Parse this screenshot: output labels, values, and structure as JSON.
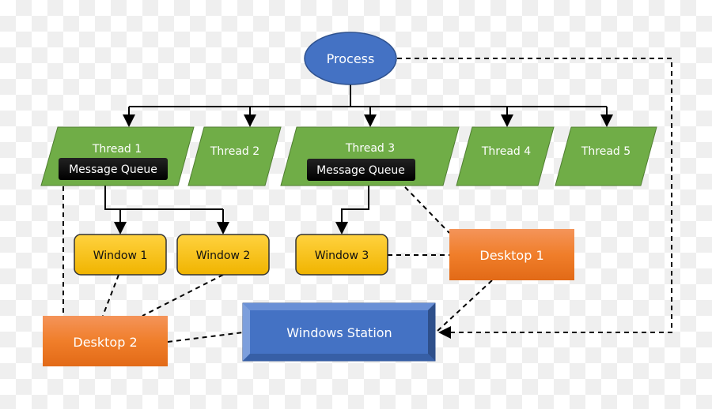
{
  "diagram": {
    "process": "Process",
    "threads": [
      "Thread 1",
      "Thread 2",
      "Thread 3",
      "Thread 4",
      "Thread 5"
    ],
    "message_queue": "Message Queue",
    "windows": [
      "Window 1",
      "Window 2",
      "Window 3"
    ],
    "desktop1": "Desktop 1",
    "desktop2": "Desktop 2",
    "station": "Windows Station"
  },
  "colors": {
    "process": "#4472c4",
    "thread": "#70ad47",
    "window": "#ffc000",
    "desktop": "#ed7d31",
    "station": "#4472c4",
    "queue": "#000000"
  }
}
